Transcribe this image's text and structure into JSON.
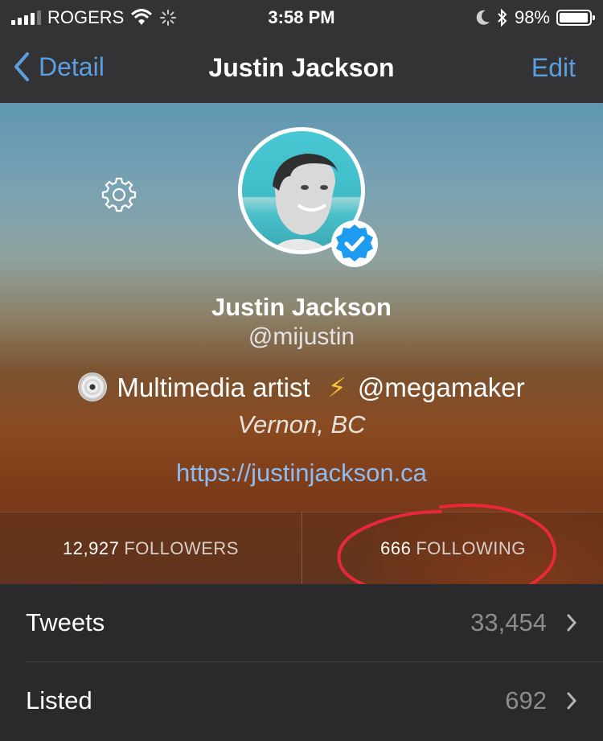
{
  "status": {
    "carrier": "ROGERS",
    "time": "3:58 PM",
    "battery": "98%",
    "battery_level": 0.98,
    "icons": [
      "signal-icon",
      "wifi-icon",
      "activity-spinner-icon",
      "moon-icon",
      "bluetooth-icon",
      "battery-icon"
    ]
  },
  "nav": {
    "back_label": "Detail",
    "title": "Justin Jackson",
    "edit_label": "Edit"
  },
  "profile": {
    "name": "Justin Jackson",
    "handle": "@mijustin",
    "bio_emoji_1": "cd-icon",
    "bio_text": "Multimedia artist",
    "bio_emoji_2": "⚡",
    "bio_mention": "@megamaker",
    "location": "Vernon, BC",
    "url": "https://justinjackson.ca",
    "verified": true
  },
  "stats": {
    "followers_count": "12,927",
    "followers_label": "FOLLOWERS",
    "following_count": "666",
    "following_label": "FOLLOWING"
  },
  "list": [
    {
      "label": "Tweets",
      "value": "33,454"
    },
    {
      "label": "Listed",
      "value": "692"
    }
  ],
  "colors": {
    "accent": "#5b9fde",
    "link": "#8ebcf0",
    "annotation": "#e8283a"
  }
}
